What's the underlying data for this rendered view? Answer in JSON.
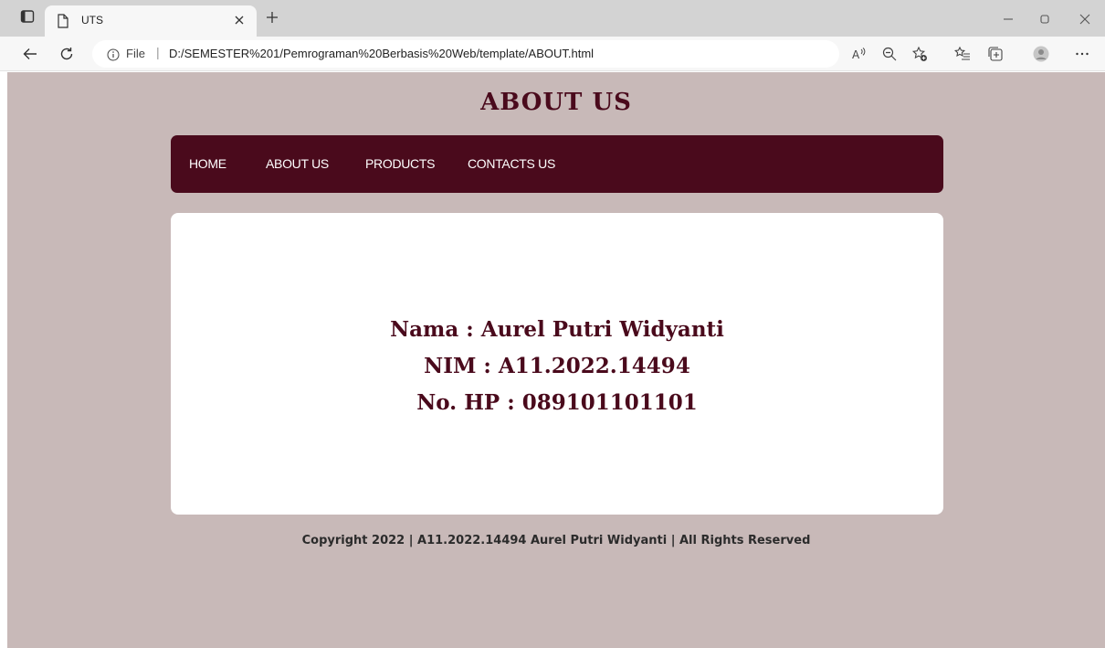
{
  "browser": {
    "tab": {
      "title": "UTS"
    },
    "address": {
      "scheme_label": "File",
      "separator": "|",
      "url": "D:/SEMESTER%201/Pemrograman%20Berbasis%20Web/template/ABOUT.html"
    },
    "icons": {
      "tab_actions": "tab-actions-icon",
      "page": "page-icon",
      "close": "close-icon",
      "new_tab": "plus-icon",
      "back": "back-arrow-icon",
      "refresh": "refresh-icon",
      "info": "info-icon",
      "read_aloud": "read-aloud-icon",
      "zoom": "zoom-out-icon",
      "favorite": "star-add-icon",
      "favorites": "favorites-icon",
      "collections": "collections-icon",
      "profile": "profile-icon",
      "more": "more-icon"
    }
  },
  "page": {
    "title": "ABOUT US",
    "nav": [
      "HOME",
      "ABOUT US",
      "PRODUCTS",
      "CONTACTS US"
    ],
    "content": {
      "nama": "Nama : Aurel Putri Widyanti",
      "nim": "NIM : A11.2022.14494",
      "hp": "No. HP : 089101101101"
    },
    "footer": "Copyright 2022 | A11.2022.14494 Aurel Putri Widyanti | All Rights Reserved"
  },
  "colors": {
    "page_background": "#c8b9b8",
    "primary": "#4a0a1c",
    "panel": "#ffffff"
  }
}
